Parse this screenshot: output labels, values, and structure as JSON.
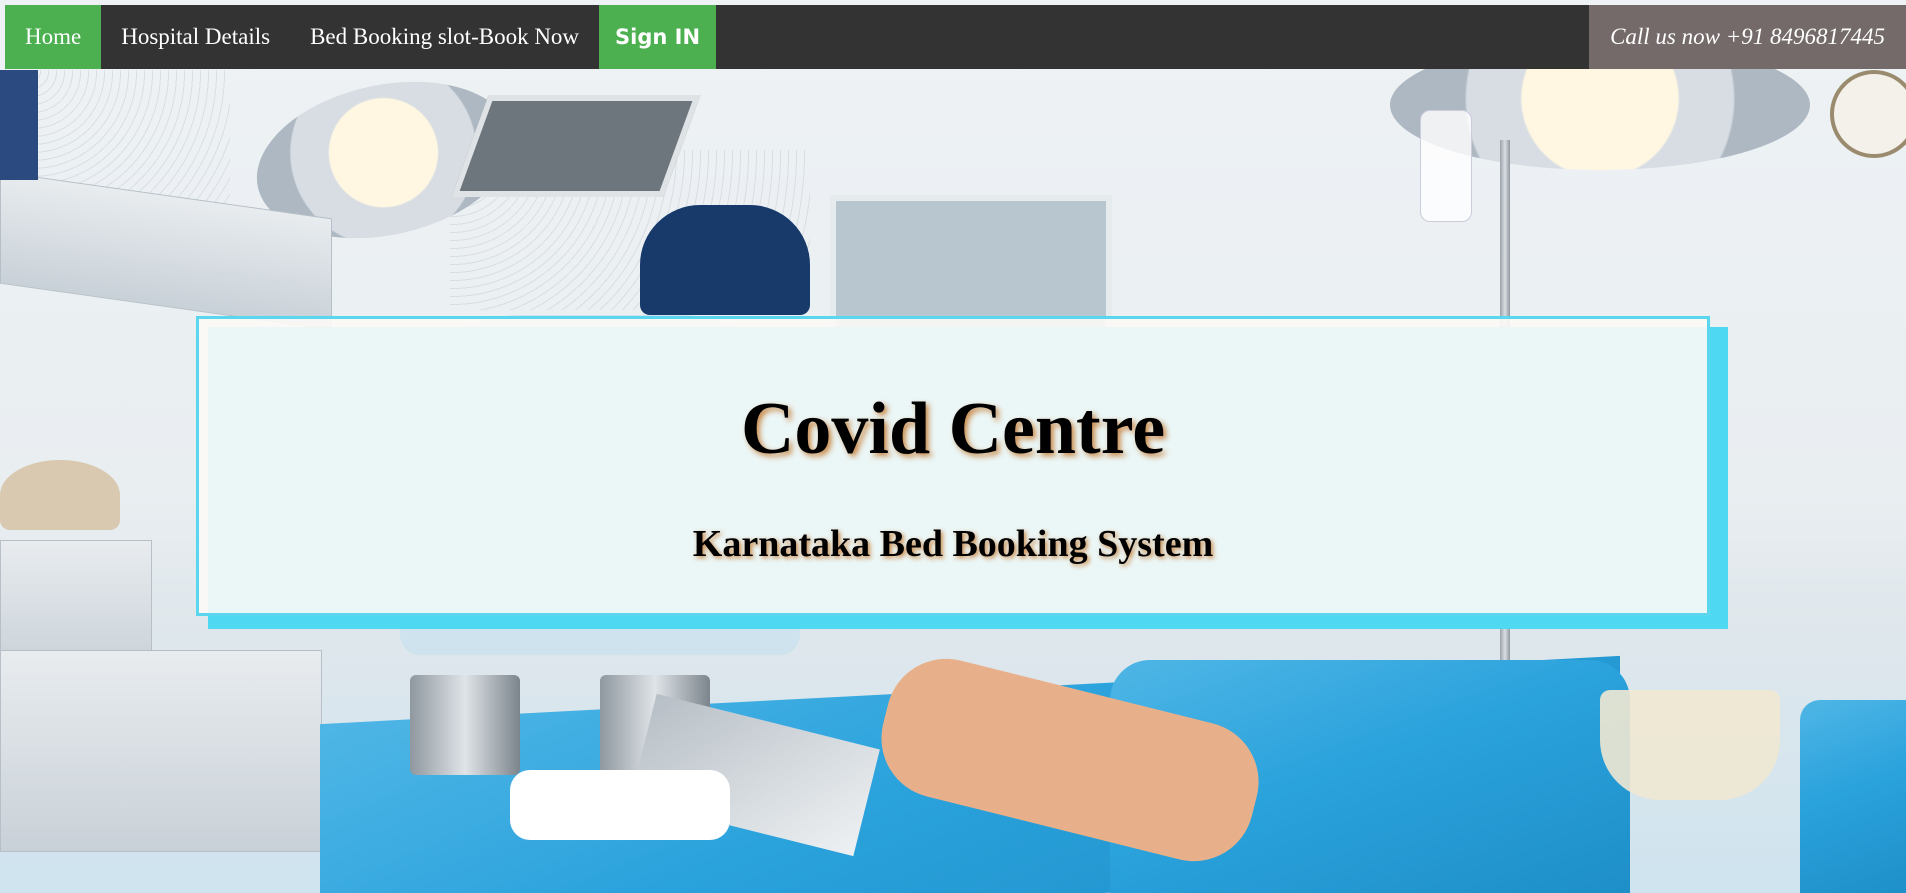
{
  "nav": {
    "items": [
      {
        "label": "Home",
        "active": true
      },
      {
        "label": "Hospital Details",
        "active": false
      },
      {
        "label": "Bed Booking slot-Book Now",
        "active": false
      }
    ],
    "signin_label": "Sign IN",
    "call_label": "Call us now +91 8496817445"
  },
  "hero": {
    "title": "Covid Centre",
    "subtitle": "Karnataka Bed Booking System"
  },
  "colors": {
    "nav_bg": "#333333",
    "active_green": "#4caf50",
    "call_bg": "#756a6a",
    "card_border": "#5bd6ef",
    "drape_blue": "#2aa2dc"
  }
}
